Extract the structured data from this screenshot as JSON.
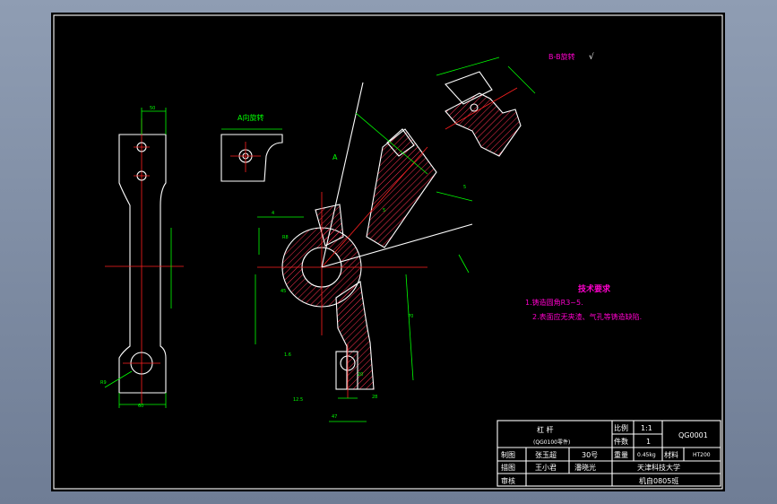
{
  "colors": {
    "background": "#7d8ba2",
    "canvas": "#000000",
    "outline": "#ffffff",
    "dimension": "#00ff00",
    "centerline": "#ff2020",
    "section_hatch": "#ff3050",
    "notes": "#ff00cc"
  },
  "views": {
    "section_label": "B-B旋转",
    "detail_label": "A向旋转",
    "arrow_letter": "A",
    "roughness_symbol": "√"
  },
  "notes": {
    "title": "技术要求",
    "items": [
      "1.铸造圆角R3~5.",
      "2.表面应无夹渣、气孔等铸造缺陷."
    ]
  },
  "title_block": {
    "part_name": "杠  杆",
    "part_subtitle": "(QG0100零件)",
    "drawing_no": "QG0001",
    "scale_label": "比例",
    "scale_value": "1:1",
    "qty_label": "件数",
    "qty_value": "1",
    "weight_label": "重量",
    "weight_value": "0.45kg",
    "material_label": "材料",
    "material_value": "HT200",
    "drawn_label": "制图",
    "drawn_name": "张玉超",
    "student_no": "30号",
    "design_label": "描图",
    "design_name": "王小君",
    "check_name": "潘晓光",
    "review_label": "审核",
    "school": "天津科技大学",
    "class": "机自0805班"
  },
  "dimensions": [
    "60",
    "R9",
    "50",
    "R8",
    "4",
    "5",
    "5",
    "45",
    "1.6",
    "12.5",
    "70",
    "20",
    "47",
    "28"
  ]
}
